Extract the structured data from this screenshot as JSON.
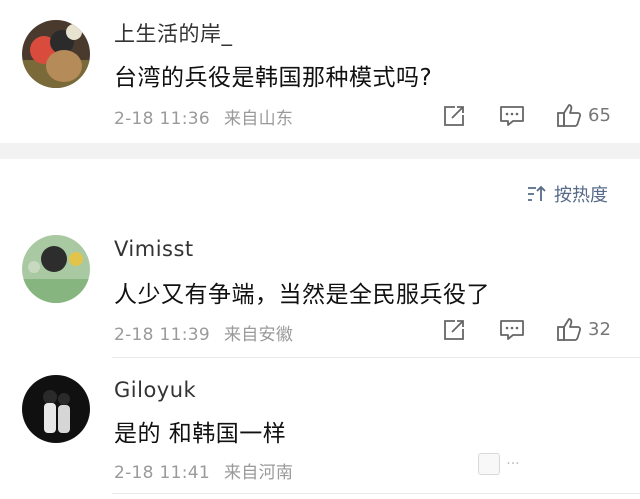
{
  "post": {
    "username": "上生活的岸_",
    "content": "台湾的兵役是韩国那种模式吗?",
    "date": "2-18 11:36",
    "location": "来自山东",
    "like_count": "65"
  },
  "sort": {
    "label": "按热度"
  },
  "comments": [
    {
      "username": "Vimisst",
      "content": "人少又有争端，当然是全民服兵役了",
      "date": "2-18 11:39",
      "location": "来自安徽",
      "like_count": "32"
    },
    {
      "username": "Giloyuk",
      "content": "是的 和韩国一样",
      "date": "2-18 11:41",
      "location": "来自河南"
    }
  ],
  "icons": [
    "share-icon",
    "comment-icon",
    "like-icon",
    "sort-icon"
  ],
  "colors": {
    "accent": "#566a89",
    "meta": "#9a9a9a",
    "separator": "#f2f2f2"
  }
}
